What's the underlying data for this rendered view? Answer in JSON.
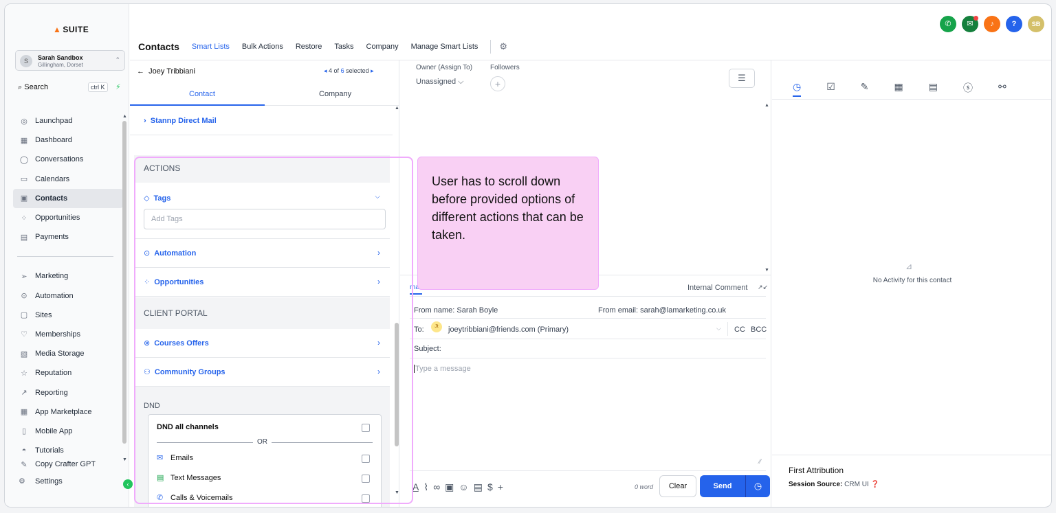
{
  "app": {
    "logo": "SUITE",
    "account_name": "Sarah Sandbox",
    "account_location": "Gillingham, Dorset",
    "account_initials": "S"
  },
  "search": {
    "label": "Search",
    "shortcut": "ctrl K"
  },
  "nav": {
    "items": [
      {
        "label": "Launchpad",
        "icon": "rocket-icon"
      },
      {
        "label": "Dashboard",
        "icon": "grid-icon"
      },
      {
        "label": "Conversations",
        "icon": "chat-icon"
      },
      {
        "label": "Calendars",
        "icon": "calendar-icon"
      },
      {
        "label": "Contacts",
        "icon": "contacts-icon",
        "active": true
      },
      {
        "label": "Opportunities",
        "icon": "opportunities-icon"
      },
      {
        "label": "Payments",
        "icon": "payments-icon"
      }
    ],
    "items2": [
      {
        "label": "Marketing",
        "icon": "send-icon"
      },
      {
        "label": "Automation",
        "icon": "automation-icon"
      },
      {
        "label": "Sites",
        "icon": "sites-icon"
      },
      {
        "label": "Memberships",
        "icon": "memberships-icon"
      },
      {
        "label": "Media Storage",
        "icon": "media-icon"
      },
      {
        "label": "Reputation",
        "icon": "star-icon"
      },
      {
        "label": "Reporting",
        "icon": "reporting-icon"
      },
      {
        "label": "App Marketplace",
        "icon": "apps-icon"
      },
      {
        "label": "Mobile App",
        "icon": "mobile-icon"
      },
      {
        "label": "Tutorials",
        "icon": "tutorials-icon"
      },
      {
        "label": "Copy Crafter GPT",
        "icon": "copy-icon"
      }
    ],
    "settings": "Settings"
  },
  "header": {
    "tabs": [
      "Contacts",
      "Smart Lists",
      "Bulk Actions",
      "Restore",
      "Tasks",
      "Company",
      "Manage Smart Lists"
    ],
    "avatar_initials": "SB"
  },
  "contact": {
    "name": "Joey Tribbiani",
    "pager_current": "4 of",
    "pager_total": "6",
    "pager_suffix": "selected",
    "tab_contact": "Contact",
    "tab_company": "Company",
    "stannp": "Stannp Direct Mail",
    "actions_heading": "ACTIONS",
    "tags_label": "Tags",
    "tags_placeholder": "Add Tags",
    "automation_label": "Automation",
    "opportunities_label": "Opportunities",
    "client_portal_heading": "CLIENT PORTAL",
    "courses_label": "Courses Offers",
    "community_label": "Community Groups",
    "dnd_heading": "DND",
    "dnd_all": "DND all channels",
    "dnd_or": "OR",
    "dnd_channels": [
      "Emails",
      "Text Messages",
      "Calls & Voicemails"
    ]
  },
  "owner": {
    "label": "Owner (Assign To)",
    "value": "Unassigned",
    "followers_label": "Followers"
  },
  "composer": {
    "tab": "mail",
    "internal_comment": "Internal Comment",
    "from_name_label": "From name:",
    "from_name": "Sarah Boyle",
    "from_email_label": "From email:",
    "from_email": "sarah@lamarketing.co.uk",
    "to_label": "To:",
    "to_initials": "Jt",
    "to_value": "joeytribbiani@friends.com (Primary)",
    "cc": "CC",
    "bcc": "BCC",
    "subject_label": "Subject:",
    "message_placeholder": "Type a message",
    "word_count": "0 word",
    "clear": "Clear",
    "send": "Send"
  },
  "activity": {
    "empty": "No Activity for this contact",
    "attribution_title": "First Attribution",
    "session_source_label": "Session Source:",
    "session_source_value": "CRM UI"
  },
  "annotation": {
    "text": "User has to scroll down before provided options of different actions that can be taken."
  },
  "colors": {
    "accent": "#2563eb",
    "highlight": "#f0abfc",
    "callout_bg": "#f9d0f4"
  }
}
